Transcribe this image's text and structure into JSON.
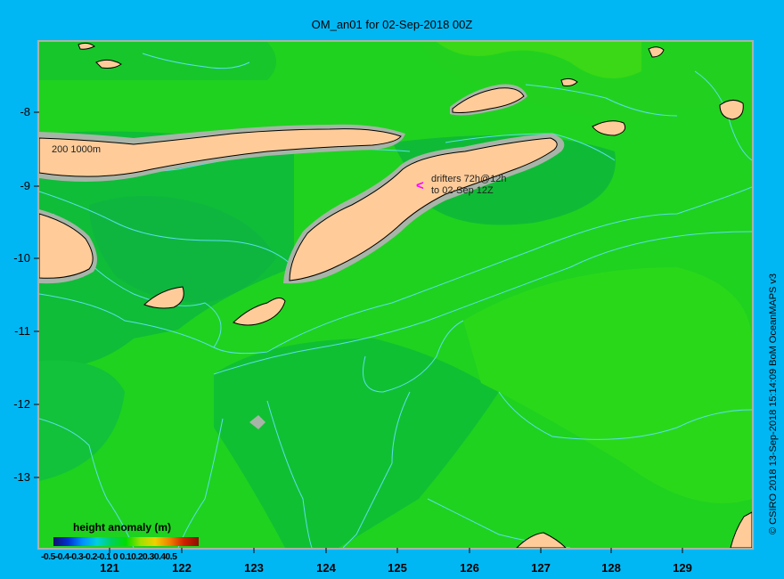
{
  "title": "OM_an01 for 02-Sep-2018 00Z",
  "credit": "© CSIRO 2018   13-Sep-2018 15:14:09 BoM OceanMAPS v3",
  "y_axis": {
    "labels": [
      "-8",
      "-9",
      "-10",
      "-11",
      "-12",
      "-13"
    ]
  },
  "x_axis": {
    "labels": [
      "121",
      "122",
      "123",
      "124",
      "125",
      "126",
      "127",
      "128",
      "129"
    ]
  },
  "legend": {
    "title": "height anomaly (m)",
    "ticks": "-0.5-0.4-0.3-0.2-0.1  0  0.10.20.30.40.5",
    "min": -0.5,
    "max": 0.5
  },
  "annotations": {
    "drifter_line1": "drifters 72h@12h",
    "drifter_line2": "to 02-Sep 12Z",
    "drifter_marker": "<",
    "depth_contours": "200  1000m"
  },
  "colors": {
    "background": "#00b7f4",
    "ocean_green": "#1fd21f",
    "ocean_dark": "#10bb30",
    "ocean_light": "#33e01a",
    "land": "#ffcc99",
    "shelf": "#a8b4a8",
    "contour": "#5ae0ee",
    "drifter": "#ff00ff"
  }
}
